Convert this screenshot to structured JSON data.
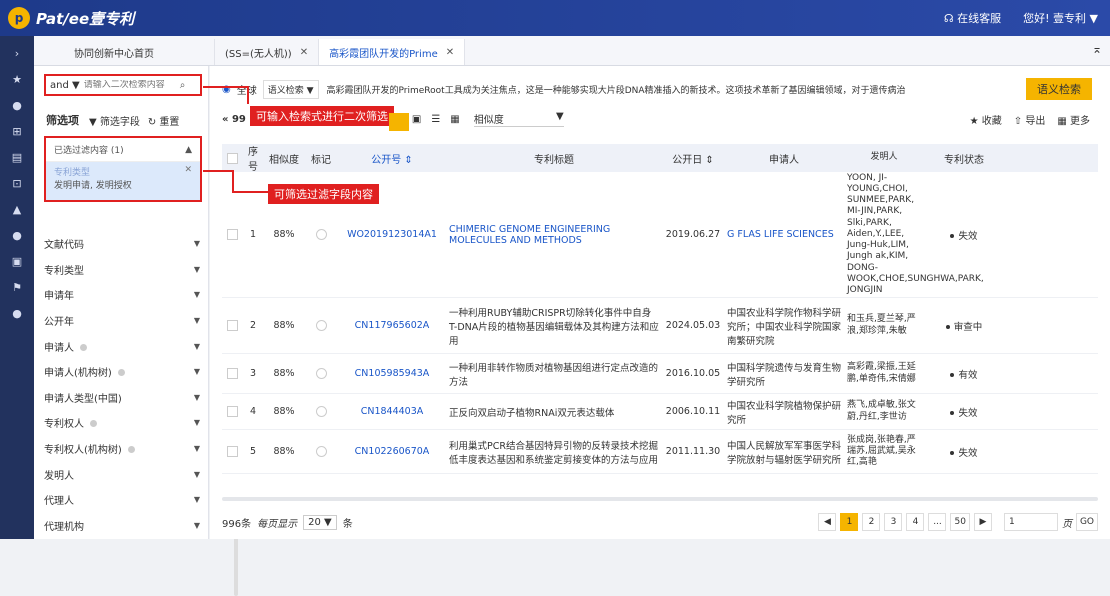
{
  "header": {
    "logo_letter": "p",
    "logo_text": "Pat/ee壹专利",
    "support": "在线客服",
    "greeting": "您好! 壹专利 ▼"
  },
  "leftnav": [
    "›",
    "★",
    "●",
    "⊞",
    "▤",
    "⊡",
    "▲",
    "●",
    "▣",
    "⚑",
    "●"
  ],
  "tabs": [
    {
      "label": "协同创新中心首页",
      "active": false
    },
    {
      "label": "(SS=(无人机))",
      "active": false
    },
    {
      "label": "高彩霞团队开发的Prime",
      "active": true
    }
  ],
  "sidebar": {
    "search_mode": "and ▼",
    "search_placeholder": "请输入二次检索内容",
    "filter_title": "筛选项",
    "filter_field_btn": "▼ 筛选字段",
    "reset_btn": "↻ 重置",
    "filtered_header": "已选过滤内容 (1)",
    "filtered_type_label": "专利类型",
    "filtered_type_value": "发明申请, 发明授权",
    "filters": [
      {
        "label": "文献代码",
        "dot": false
      },
      {
        "label": "专利类型",
        "dot": false
      },
      {
        "label": "申请年",
        "dot": false
      },
      {
        "label": "公开年",
        "dot": false
      },
      {
        "label": "申请人",
        "dot": true
      },
      {
        "label": "申请人(机构树)",
        "dot": true
      },
      {
        "label": "申请人类型(中国)",
        "dot": false
      },
      {
        "label": "专利权人",
        "dot": true
      },
      {
        "label": "专利权人(机构树)",
        "dot": true
      },
      {
        "label": "发明人",
        "dot": false
      },
      {
        "label": "代理人",
        "dot": false
      },
      {
        "label": "代理机构",
        "dot": false
      }
    ]
  },
  "query": {
    "scope": "全球",
    "search_type": "语义检索 ▼",
    "text": "高彩霞团队开发的PrimeRoot工具成为关注焦点，这是一种能够实现大片段DNA精准插入的新技术。这项技术革新了基因编辑领域，对于遗传病治",
    "button": "语义检索"
  },
  "toolbar": {
    "prev": "« 99",
    "sort": "相似度",
    "favorite": "★ 收藏",
    "export": "⇧ 导出",
    "more": "▦ 更多"
  },
  "table": {
    "headers": [
      "序号",
      "相似度",
      "标记",
      "公开号 ⇕",
      "专利标题",
      "公开日 ⇕",
      "申请人",
      "发明人",
      "专利状态"
    ],
    "rows": [
      {
        "no": "1",
        "sim": "88%",
        "pub": "WO2019123014A1",
        "title": "CHIMERIC GENOME ENGINEERING MOLECULES AND METHODS",
        "title_link": true,
        "date": "2019.06.27",
        "applicant": "G FLAS LIFE SCIENCES",
        "app_link": true,
        "inventor": "YOON, JI-YOUNG,CHOI, SUNMEE,PARK, MI-JIN,PARK, Slki,PARK, Aiden,Y.,LEE, Jung-Huk,LIM, Jungh ak,KIM, DONG-WOOK,CHOE,SUNGHWA,PARK, JONGJIN",
        "status": "失效"
      },
      {
        "no": "2",
        "sim": "88%",
        "pub": "CN117965602A",
        "title": "一种利用RUBY辅助CRISPR切除转化事件中自身T-DNA片段的植物基因编辑载体及其构建方法和应用",
        "title_link": false,
        "date": "2024.05.03",
        "applicant": "中国农业科学院作物科学研究所；中国农业科学院国家南繁研究院",
        "app_link": false,
        "inventor": "和玉兵,夏兰琴,严浪,郑珍萍,朱敏",
        "status": "审查中"
      },
      {
        "no": "3",
        "sim": "88%",
        "pub": "CN105985943A",
        "title": "一种利用非转作物质对植物基因组进行定点改造的方法",
        "title_link": false,
        "date": "2016.10.05",
        "applicant": "中国科学院遗传与发育生物学研究所",
        "app_link": false,
        "inventor": "高彩霞,梁振,王延鹏,单奇伟,宋倩娜",
        "status": "有效"
      },
      {
        "no": "4",
        "sim": "88%",
        "pub": "CN1844403A",
        "title": "正反向双启动子植物RNAi双元表达载体",
        "title_link": false,
        "date": "2006.10.11",
        "applicant": "中国农业科学院植物保护研究所",
        "app_link": false,
        "inventor": "燕飞,成卓敏,张文蔚,丹红,李世访",
        "status": "失效"
      },
      {
        "no": "5",
        "sim": "88%",
        "pub": "CN102260670A",
        "title": "利用巢式PCR结合基因特异引物的反转录技术挖掘低丰度表达基因和系统鉴定剪接变体的方法与应用",
        "title_link": false,
        "date": "2011.11.30",
        "applicant": "中国人民解放军军事医学科学院放射与辐射医学研究所",
        "app_link": false,
        "inventor": "张成岗,张艳春,严瑞苏,屈武斌,吴永红,高艳",
        "status": "失效"
      }
    ]
  },
  "footer": {
    "count": "996条",
    "per_page_label": "每页显示",
    "per_page": "20 ▼",
    "unit": "条",
    "pages": [
      "◀",
      "1",
      "2",
      "3",
      "4",
      "...",
      "50",
      "▶"
    ],
    "goto_value": "1",
    "page_label": "页",
    "go": "GO"
  },
  "annotations": {
    "secondary_search": "可输入检索式进行二次筛选",
    "filter_content": "可筛选过滤字段内容"
  },
  "colors": {
    "accent": "#f5b400",
    "header": "#1e3a8a",
    "link": "#1a56c8",
    "annotation": "#e02020"
  }
}
